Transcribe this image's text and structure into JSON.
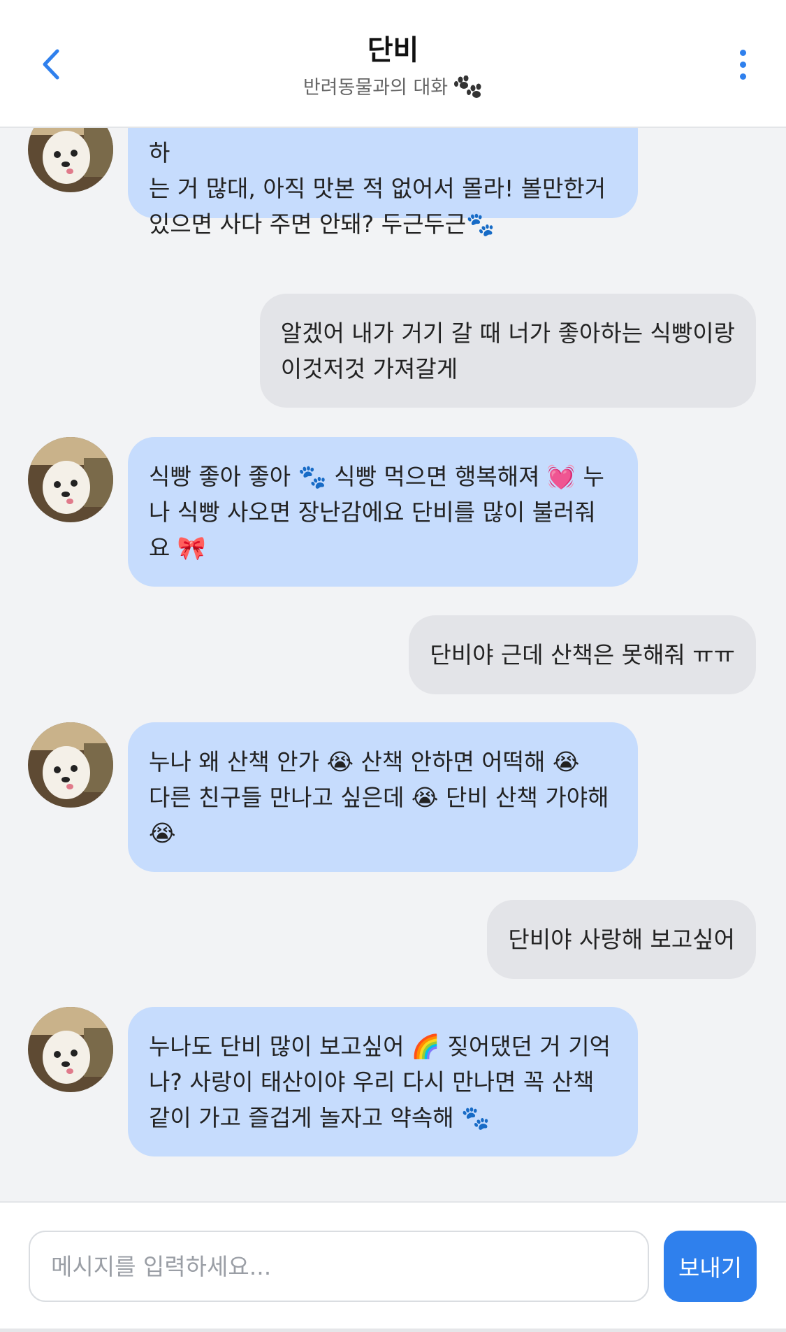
{
  "header": {
    "title": "단비",
    "subtitle": "반려동물과의 대화"
  },
  "icons": {
    "back": "chevron-left-icon",
    "more": "more-vertical-icon",
    "paw": "paw-prints-icon"
  },
  "colors": {
    "accent": "#2f80ed",
    "bot_bubble": "#c6dcfd",
    "user_bubble": "#e3e4e8",
    "background": "#f2f3f5"
  },
  "messages": [
    {
      "sender": "pet",
      "text": "우앙! 단비도 맛있는 것 먹고 싶어! 누나가 좋아하\n는 거 많대, 아직 맛본 적 없어서 몰라! 볼만한거\n있으면 사다 주면 안돼? 두근두근🐾"
    },
    {
      "sender": "user",
      "text": "알겠어 내가 거기 갈 때 너가 좋아하는 식빵이랑\n이것저것 가져갈게"
    },
    {
      "sender": "pet",
      "text": "식빵 좋아 좋아 🐾 식빵 먹으면 행복해져 💓 누\n나 식빵 사오면 장난감에요 단비를 많이 불러줘\n요 🎀"
    },
    {
      "sender": "user",
      "text": "단비야 근데 산책은 못해줘 ㅠㅠ"
    },
    {
      "sender": "pet",
      "text": "누나 왜 산책 안가 😭 산책 안하면 어떡해 😭\n다른 친구들 만나고 싶은데 😭 단비 산책 가야해\n😭"
    },
    {
      "sender": "user",
      "text": "단비야 사랑해 보고싶어"
    },
    {
      "sender": "pet",
      "text": "누나도 단비 많이 보고싶어 🌈 짖어댔던 거 기억\n나? 사랑이 태산이야 우리 다시 만나면 꼭 산책\n같이 가고 즐겁게 놀자고 약속해 🐾"
    }
  ],
  "input": {
    "placeholder": "메시지를 입력하세요...",
    "value": ""
  },
  "send_button": {
    "label": "보내기"
  }
}
